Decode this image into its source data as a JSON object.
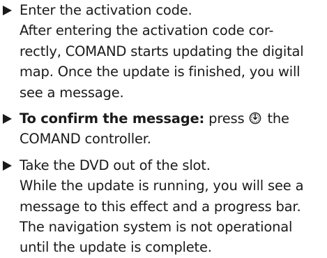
{
  "steps": [
    {
      "lines": [
        "Enter the activation code.",
        "After entering the activation code cor-",
        "rectly, COMAND starts updating the digital",
        "map. Once the update is finished, you will",
        "see a message."
      ]
    },
    {
      "bold_label": "To confirm the message:",
      "text_before_icon": "press",
      "icon": "press-controller-icon",
      "text_after_icon": "the",
      "line2": "COMAND controller."
    },
    {
      "lines": [
        "Take the DVD out of the slot.",
        "While the update is running, you will see a",
        "message to this effect and a progress bar.",
        "The navigation system is not operational",
        "until the update is complete."
      ]
    }
  ],
  "colors": {
    "text": "#1a1a1a",
    "background": "#ffffff"
  }
}
